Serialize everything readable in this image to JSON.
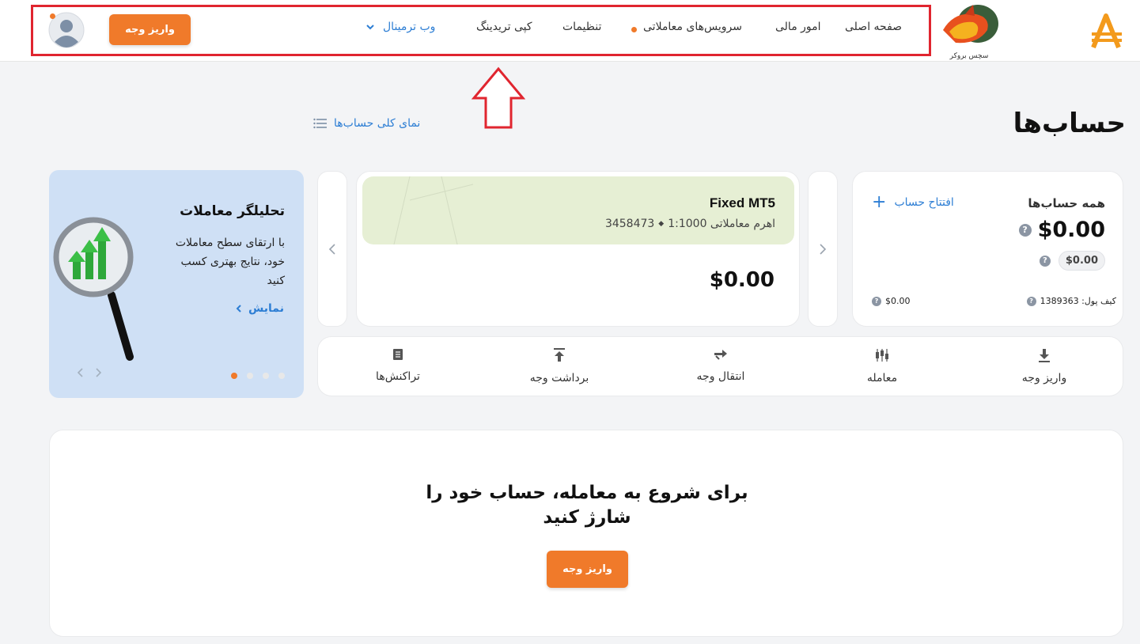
{
  "header": {
    "nav": {
      "home": "صفحه اصلی",
      "finance": "امور مالی",
      "services": "سرویس‌های معاملاتی",
      "settings": "تنظیمات",
      "copy_trading": "کپی تریدینگ",
      "web_terminal": "وب ترمینال"
    },
    "deposit_label": "واریز وجه",
    "broker_logo_text": "سچس بروکر"
  },
  "page": {
    "title": "حساب‌ها",
    "overview_link": "نمای کلی حساب‌ها"
  },
  "summary": {
    "title": "همه حساب‌ها",
    "open_account": "افتتاح حساب",
    "total": "$0.00",
    "sub_total": "$0.00",
    "wallet_label": "کیف پول: 1389363",
    "wallet_value": "$0.00"
  },
  "account": {
    "name": "Fixed MT5",
    "number": "3458473",
    "leverage": "اهرم معاملاتی 1:1000",
    "balance": "$0.00"
  },
  "promo": {
    "title": "تحلیلگر معاملات",
    "text": "با ارتقای سطح معاملات خود، نتایج بهتری کسب کنید",
    "link": "نمایش"
  },
  "actions": {
    "deposit": "واریز وجه",
    "trade": "معامله",
    "transfer": "انتقال وجه",
    "withdraw": "برداشت وجه",
    "transactions": "تراکنش‌ها"
  },
  "cta": {
    "text": "برای شروع به معامله، حساب خود را شارژ کنید",
    "button": "واریز وجه"
  },
  "colors": {
    "accent": "#f07a2a",
    "link": "#2d7ed4",
    "annotation": "#e0252f"
  }
}
